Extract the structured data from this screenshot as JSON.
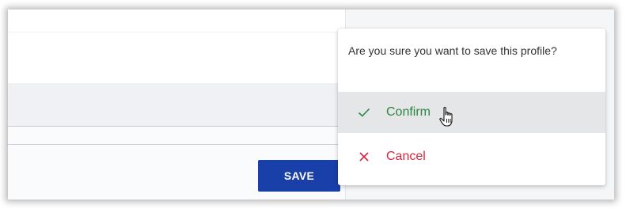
{
  "form": {
    "save_label": "SAVE"
  },
  "popover": {
    "prompt": "Are you sure you want to save this profile?",
    "items": [
      {
        "label": "Confirm",
        "icon": "check-icon",
        "color": "#2e8540",
        "hovered": true
      },
      {
        "label": "Cancel",
        "icon": "close-icon",
        "color": "#d7263d",
        "hovered": false
      }
    ]
  },
  "colors": {
    "save_button_bg": "#1940a8",
    "hover_bg": "#e5e6e8"
  },
  "cursor": "hand-pointer-icon"
}
